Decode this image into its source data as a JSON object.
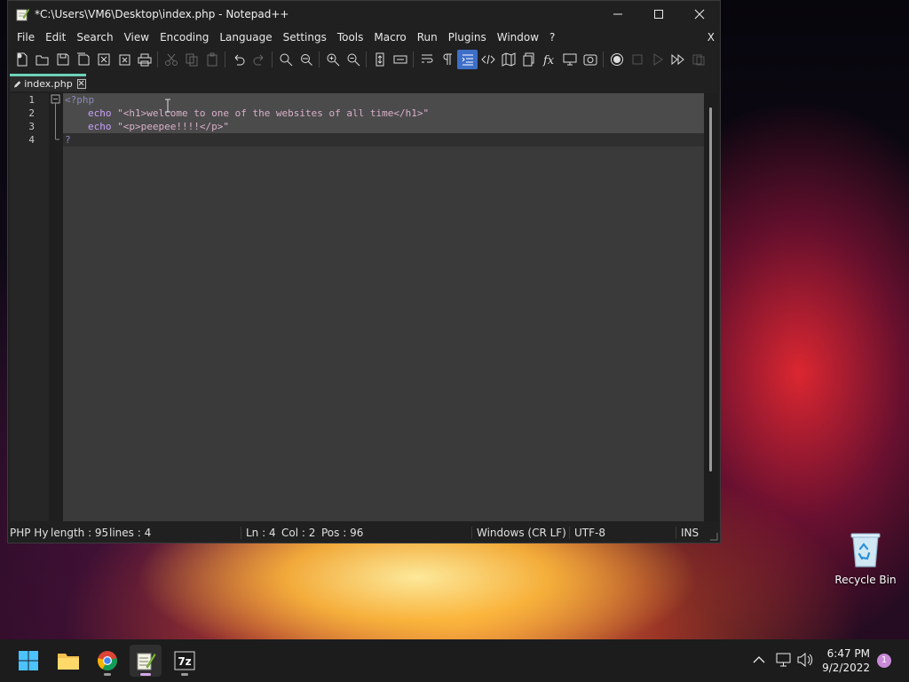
{
  "window": {
    "title": "*C:\\Users\\VM6\\Desktop\\index.php - Notepad++",
    "minimize": "—",
    "maximize": "☐",
    "close": "✕"
  },
  "menu": {
    "items": [
      "File",
      "Edit",
      "Search",
      "View",
      "Encoding",
      "Language",
      "Settings",
      "Tools",
      "Macro",
      "Run",
      "Plugins",
      "Window",
      "?"
    ],
    "close_doc": "X"
  },
  "tab": {
    "label": "index.php"
  },
  "editor": {
    "line_numbers": [
      "1",
      "2",
      "3",
      "4"
    ],
    "lines": [
      {
        "text": "<?php"
      },
      {
        "keyword": "echo",
        "string": "\"<h1>welcome to one of the websites of all time</h1>\""
      },
      {
        "keyword": "echo",
        "string": "\"<p>peepee!!!!</p>\""
      },
      {
        "text": "?"
      }
    ]
  },
  "statusbar": {
    "language": "PHP Hy",
    "length": "length : 95",
    "lines": "lines : 4",
    "ln": "Ln : 4",
    "col": "Col : 2",
    "pos": "Pos : 96",
    "eol": "Windows (CR LF)",
    "encoding": "UTF-8",
    "mode": "INS"
  },
  "desktop": {
    "recycle_bin_label": "Recycle Bin"
  },
  "taskbar": {
    "apps": [
      "start-icon",
      "file-explorer-icon",
      "chrome-icon",
      "notepadpp-icon",
      "7zip-icon"
    ],
    "sevenzip_glyph": "7z",
    "time": "6:47 PM",
    "date": "9/2/2022",
    "notification_count": "1"
  },
  "colors": {
    "accent_tab": "#6ed2b8",
    "editor_bg": "#3a3a3a",
    "selection": "#4b4b4b"
  }
}
